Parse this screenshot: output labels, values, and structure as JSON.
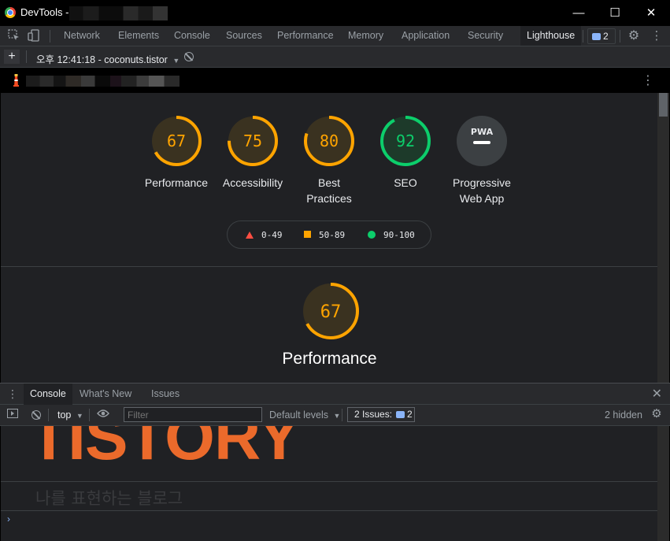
{
  "window": {
    "title": "DevTools -",
    "controls": [
      "—",
      "☐",
      "✕"
    ]
  },
  "toolbar": {
    "tabs": [
      "Network",
      "Elements",
      "Console",
      "Sources",
      "Performance",
      "Memory",
      "Application",
      "Security",
      "Lighthouse"
    ],
    "active_tab": "Lighthouse",
    "issues_count": "2"
  },
  "report_bar": {
    "report_label": "오후 12:41:18 - coconuts.tistor",
    "add_label": "+"
  },
  "categories": [
    {
      "name": "Performance",
      "score": "67",
      "color": "#ffa400",
      "value": 67
    },
    {
      "name": "Accessibility",
      "score": "75",
      "color": "#ffa400",
      "value": 75
    },
    {
      "name": "Best Practices",
      "score": "80",
      "color": "#ffa400",
      "value": 80
    },
    {
      "name": "SEO",
      "score": "92",
      "color": "#0cce6b",
      "value": 92
    },
    {
      "name": "Progressive Web App",
      "score": "PWA",
      "color": "#9aa0a6",
      "value": 0
    }
  ],
  "legend": {
    "fail": "0-49",
    "average": "50-89",
    "pass": "90-100",
    "colors": {
      "fail": "#ff4e42",
      "average": "#ffa400",
      "pass": "#0cce6b"
    }
  },
  "section": {
    "title": "Performance",
    "score": "67",
    "value": 67,
    "color": "#ffa400"
  },
  "drawer": {
    "tabs": [
      "Console",
      "What's New",
      "Issues"
    ],
    "active_tab": "Console",
    "context": "top",
    "filter_placeholder": "Filter",
    "levels": "Default levels",
    "issues_label": "2 Issues:",
    "issues_count": "2",
    "hidden": "2 hidden"
  },
  "console_output": {
    "logo_text": "TISTORY",
    "tagline": "나를 표현하는 블로그",
    "prompt": "›"
  }
}
